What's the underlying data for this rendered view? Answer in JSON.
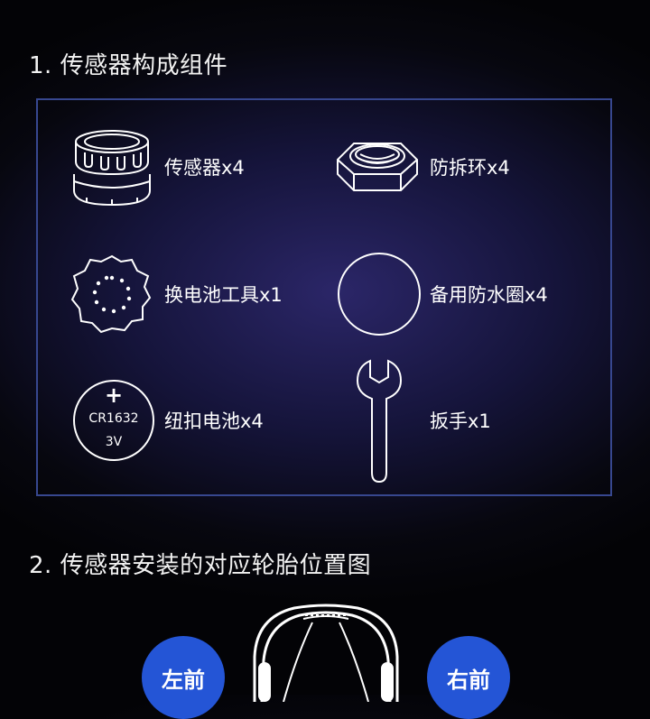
{
  "section1": {
    "title": "1. 传感器构成组件"
  },
  "components": [
    {
      "label": "传感器x4",
      "icon": "tpms-sensor-icon"
    },
    {
      "label": "防拆环x4",
      "icon": "hex-nut-icon"
    },
    {
      "label": "换电池工具x1",
      "icon": "battery-tool-icon"
    },
    {
      "label": "备用防水圈x4",
      "icon": "o-ring-icon"
    },
    {
      "label": "纽扣电池x4",
      "icon": "coin-battery-icon"
    },
    {
      "label": "扳手x1",
      "icon": "wrench-icon"
    }
  ],
  "battery": {
    "symbol": "+",
    "model": "CR1632",
    "voltage": "3V"
  },
  "section2": {
    "title": "2. 传感器安装的对应轮胎位置图"
  },
  "position_figure": {
    "front_left": "左前",
    "front_right": "右前"
  },
  "colors": {
    "badge": "#2455d6",
    "box_border": "#37478f",
    "background": "#07070f"
  }
}
